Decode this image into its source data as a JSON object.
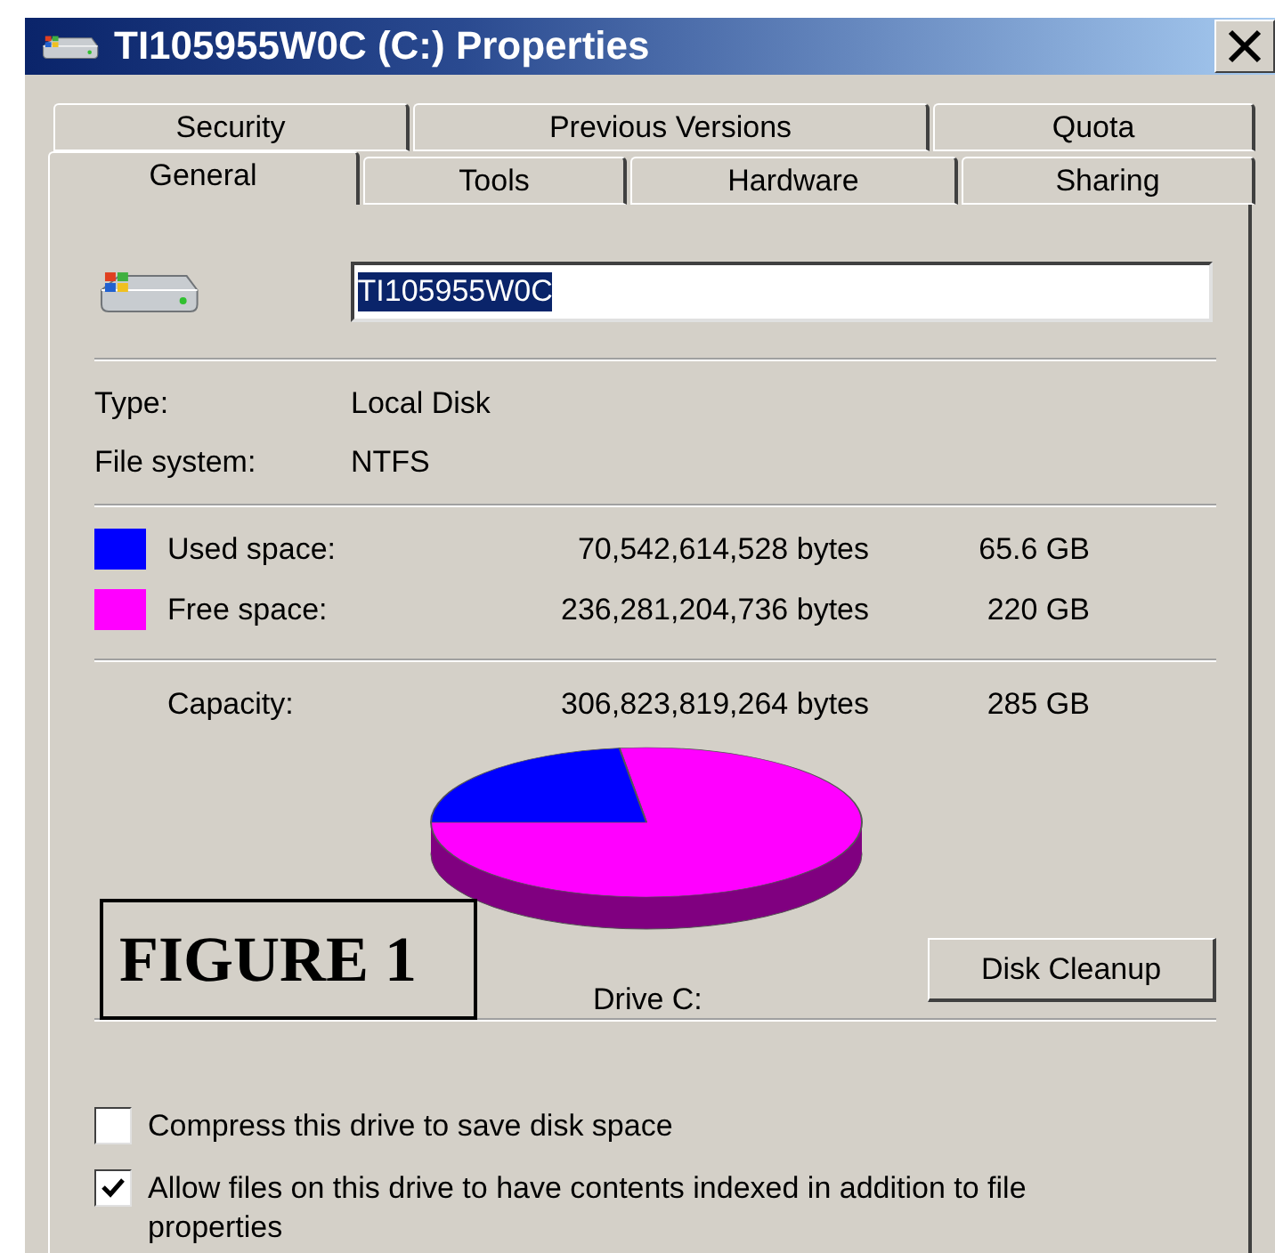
{
  "window": {
    "title": "TI105955W0C (C:) Properties"
  },
  "tabs": {
    "back_row": [
      {
        "label": "Security",
        "selected": false
      },
      {
        "label": "Previous Versions",
        "selected": false
      },
      {
        "label": "Quota",
        "selected": false
      }
    ],
    "front_row": [
      {
        "label": "General",
        "selected": true
      },
      {
        "label": "Tools",
        "selected": false
      },
      {
        "label": "Hardware",
        "selected": false
      },
      {
        "label": "Sharing",
        "selected": false
      }
    ]
  },
  "name_field": {
    "value": "TI105955W0C",
    "text_selected": true
  },
  "info": [
    {
      "label": "Type:",
      "value": "Local Disk"
    },
    {
      "label": "File system:",
      "value": "NTFS"
    }
  ],
  "space": [
    {
      "label": "Used space:",
      "bytes": "70,542,614,528 bytes",
      "size": "65.6 GB",
      "color": "#0000ff"
    },
    {
      "label": "Free space:",
      "bytes": "236,281,204,736 bytes",
      "size": "220 GB",
      "color": "#ff00ff"
    }
  ],
  "capacity": {
    "label": "Capacity:",
    "bytes": "306,823,819,264 bytes",
    "size": "285 GB"
  },
  "drive_label": "Drive C:",
  "figure_label": "FIGURE 1",
  "cleanup_button": "Disk Cleanup",
  "options": [
    {
      "label": "Compress this drive to save disk space",
      "checked": false
    },
    {
      "label": "Allow files on this drive to have contents indexed in addition to file properties",
      "checked": true
    }
  ]
}
